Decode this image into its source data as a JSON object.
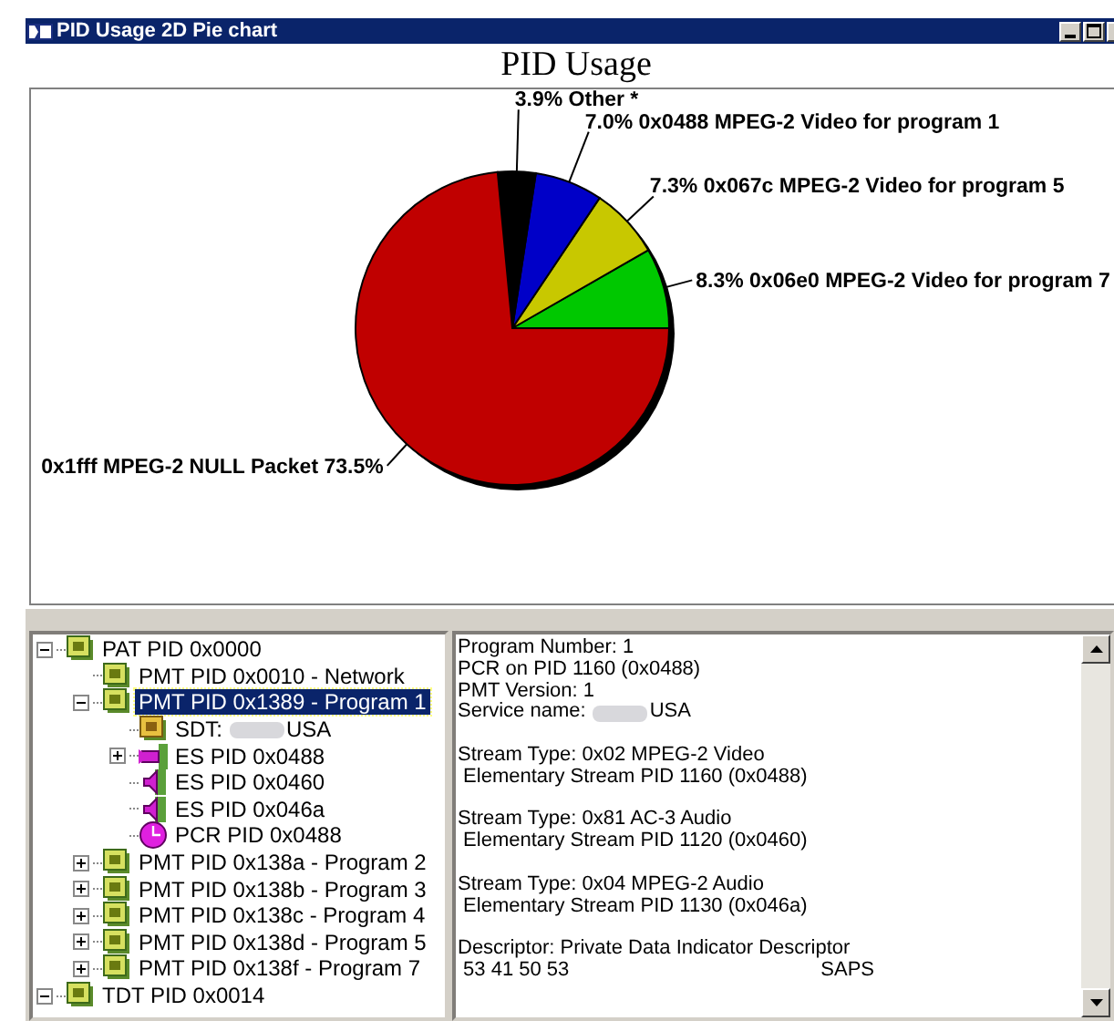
{
  "window": {
    "title": "PID Usage 2D Pie chart"
  },
  "chart": {
    "chart_data": {
      "type": "pie",
      "title": "PID Usage",
      "categories": [
        "8.3% 0x06e0 MPEG-2 Video for program 7",
        "7.3% 0x067c MPEG-2 Video for program 5",
        "7.0% 0x0488 MPEG-2 Video for program 1",
        "3.9%  Other *",
        "0x1fff MPEG-2 NULL Packet 73.5%"
      ],
      "values": [
        8.3,
        7.3,
        7.0,
        3.9,
        73.5
      ],
      "colors": [
        "#00c800",
        "#c8c800",
        "#0000c8",
        "#000000",
        "#c00000"
      ]
    }
  },
  "tree": [
    {
      "label": "PAT PID 0x0000",
      "kind": "table",
      "expanded": true,
      "selected": false,
      "children": [
        {
          "label": "PMT PID 0x0010 - Network",
          "kind": "table",
          "selected": false
        },
        {
          "label": "PMT PID 0x1389 - Program 1",
          "kind": "table",
          "expanded": true,
          "selected": true,
          "children": [
            {
              "label": "SDT:",
              "label_end": "USA",
              "redacted": true,
              "kind": "service",
              "selected": false
            },
            {
              "label": "ES PID 0x0488",
              "kind": "video",
              "expanded": false,
              "selected": false
            },
            {
              "label": "ES PID 0x0460",
              "kind": "audio",
              "selected": false
            },
            {
              "label": "ES PID 0x046a",
              "kind": "audio",
              "selected": false
            },
            {
              "label": "PCR PID 0x0488",
              "kind": "clock",
              "selected": false
            }
          ]
        },
        {
          "label": "PMT PID 0x138a - Program 2",
          "kind": "table",
          "expanded": false,
          "selected": false
        },
        {
          "label": "PMT PID 0x138b - Program 3",
          "kind": "table",
          "expanded": false,
          "selected": false
        },
        {
          "label": "PMT PID 0x138c - Program 4",
          "kind": "table",
          "expanded": false,
          "selected": false
        },
        {
          "label": "PMT PID 0x138d - Program 5",
          "kind": "table",
          "expanded": false,
          "selected": false
        },
        {
          "label": "PMT PID 0x138f - Program 7",
          "kind": "table",
          "expanded": false,
          "selected": false
        }
      ]
    },
    {
      "label": "TDT PID 0x0014",
      "kind": "table",
      "expanded": true,
      "selected": false
    }
  ],
  "details": [
    [
      {
        "text": "Program Number: 1"
      },
      {
        "text": "PCR on PID 1160 (0x0488)"
      },
      {
        "text": "PMT Version: 1"
      },
      {
        "text": "Service name:",
        "redacted": true,
        "text_end": "USA"
      }
    ],
    [
      {
        "text": "Stream Type: 0x02 MPEG-2 Video"
      },
      {
        "text": " Elementary Stream PID 1160 (0x0488)"
      }
    ],
    [
      {
        "text": "Stream Type: 0x81 AC-3 Audio"
      },
      {
        "text": " Elementary Stream PID 1120 (0x0460)"
      }
    ],
    [
      {
        "text": "Stream Type: 0x04 MPEG-2 Audio"
      },
      {
        "text": " Elementary Stream PID 1130 (0x046a)"
      }
    ],
    [
      {
        "text": "Descriptor: Private Data Indicator Descriptor"
      },
      {
        "text": " 53 41 50 53",
        "column_2": "SAPS"
      }
    ]
  ]
}
